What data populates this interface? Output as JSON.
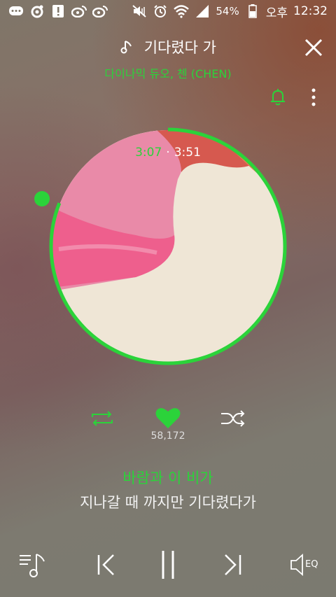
{
  "status_bar": {
    "battery": "54%",
    "period": "오후",
    "time": "12:32"
  },
  "player": {
    "song_title": "기다렸다 가",
    "artist": "다이나믹 듀오, 첸 (CHEN)",
    "current_time": "3:07",
    "time_separator": "·",
    "total_time": "3:51",
    "progress_fraction": 0.81,
    "like_count": "58,172",
    "eq_label": "EQ"
  },
  "lyrics": {
    "current": "바람과 이 비가",
    "next": "지나갈 때 까지만 기다렸다가"
  },
  "colors": {
    "accent": "#2bd33a",
    "text": "#ffffff"
  }
}
